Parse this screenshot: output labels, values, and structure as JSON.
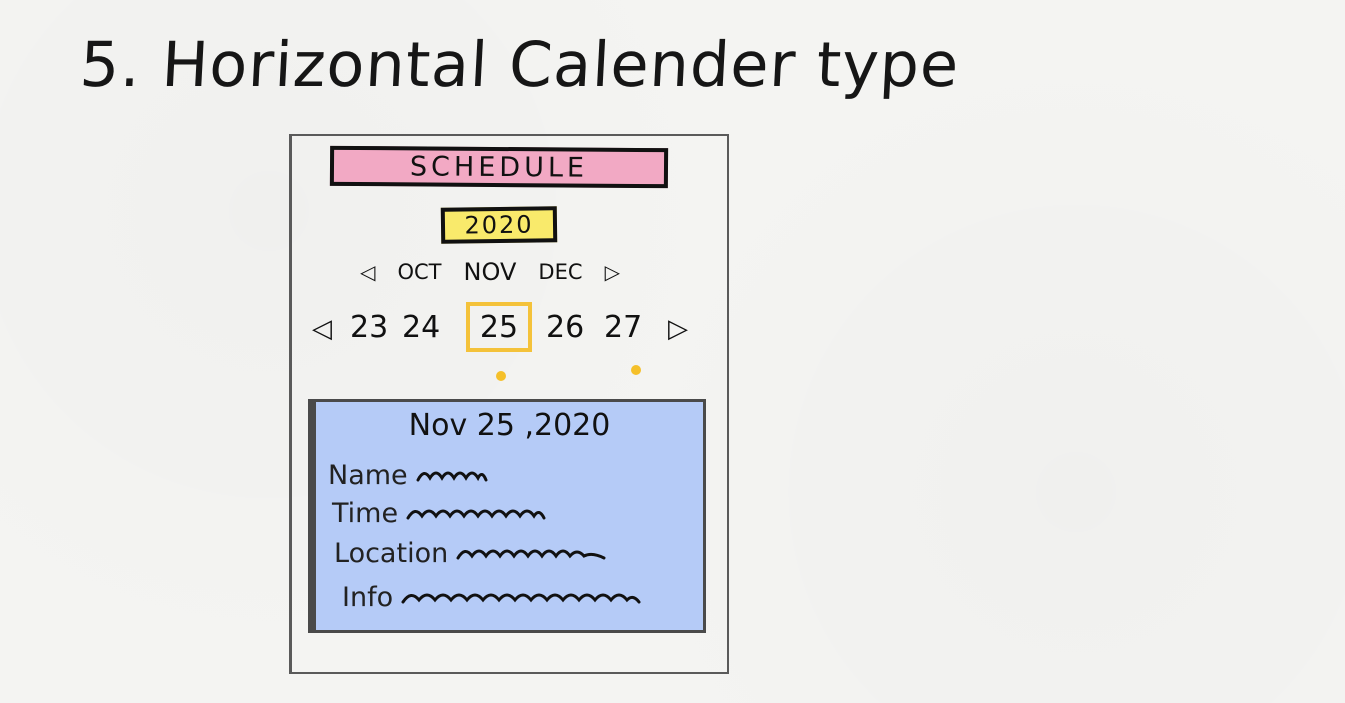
{
  "heading": "5. Horizontal Calender type",
  "app": {
    "banner": "SCHEDULE",
    "year": "2020"
  },
  "months": {
    "prev_icon": "triangle-left-icon",
    "next_icon": "triangle-right-icon",
    "prev": "OCT",
    "current": "NOV",
    "next": "DEC"
  },
  "days": {
    "prev_icon": "triangle-left-icon",
    "next_icon": "triangle-right-icon",
    "items": [
      "23",
      "24",
      "25",
      "26",
      "27"
    ],
    "selected": "25",
    "with_events": [
      "25",
      "27"
    ]
  },
  "details": {
    "date": "Nov 25 ,2020",
    "fields": [
      "Name",
      "Time",
      "Location",
      "Info"
    ]
  },
  "colors": {
    "banner_bg": "#f2a9c4",
    "year_bg": "#f9ea6b",
    "selected_day_border": "#f4c23a",
    "event_dot": "#f5c02a",
    "details_bg": "#b5cbf7"
  }
}
